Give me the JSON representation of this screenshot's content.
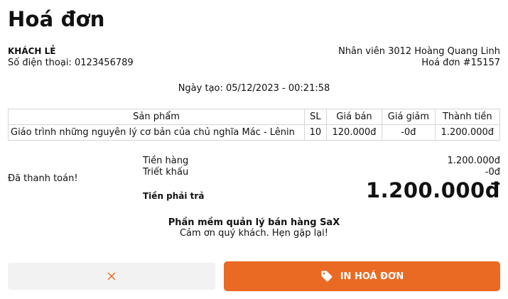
{
  "page": {
    "title": "Hoá đơn"
  },
  "customer": {
    "name": "KHÁCH LẺ",
    "phone": "Số điện thoại: 0123456789"
  },
  "meta": {
    "staff": "Nhân viên 3012 Hoàng Quang Linh",
    "invoice_no": "Hoá đơn #15157",
    "created": "Ngày tạo: 05/12/2023 - 00:21:58"
  },
  "table": {
    "headers": [
      "Sản phẩm",
      "SL",
      "Giá bán",
      "Giá giảm",
      "Thành tiền"
    ],
    "rows": [
      [
        "Giáo trình những nguyên lý cơ bản của chủ nghĩa Mác - Lênin",
        "10",
        "120.000đ",
        "-0đ",
        "1.200.000đ"
      ]
    ]
  },
  "summary": {
    "payment_status": "Đã thanh toán!",
    "subtotal_label": "Tiền hàng",
    "subtotal_value": "1.200.000đ",
    "discount_label": "Triết khấu",
    "discount_value": "-0đ",
    "total_label": "Tiền phải trả",
    "total_value": "1.200.000đ"
  },
  "footer": {
    "software": "Phần mềm quản lý bán hàng SaX",
    "thanks": "Cảm ơn quý khách. Hẹn gặp lại!"
  },
  "actions": {
    "print_label": "IN HOÁ ĐƠN",
    "cancel_icon": "close-icon",
    "print_icon": "tag-icon"
  },
  "colors": {
    "accent": "#ea6a23",
    "cancel_bg": "#f2f2f2"
  }
}
